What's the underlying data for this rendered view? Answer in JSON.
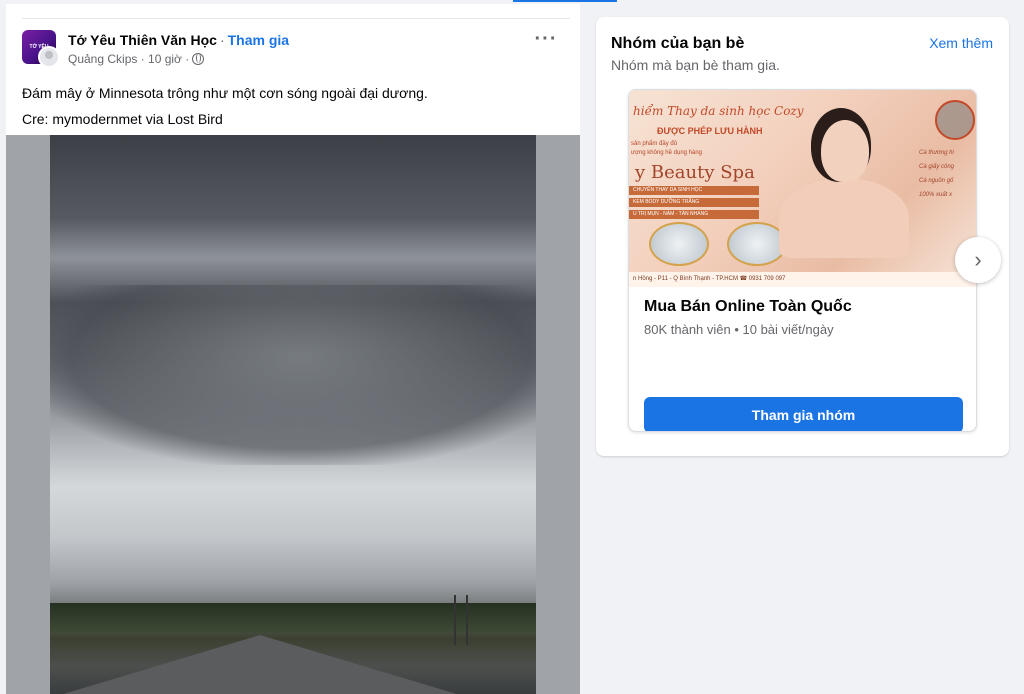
{
  "post": {
    "page_name": "Tớ Yêu Thiên Văn Học",
    "separator": "·",
    "join_label": "Tham gia",
    "meta_text": "Quảng Ckips · 10 giờ ·",
    "avatar_logo_text": "TỚ YÊU",
    "more_label": "···",
    "caption_line1": "Đám mây ở Minnesota trông như một cơn sóng ngoài đại dương.",
    "caption_line2": "Cre: mymodernmet via Lost Bird"
  },
  "panel": {
    "title": "Nhóm của bạn bè",
    "see_more": "Xem thêm",
    "subtitle": "Nhóm mà bạn bè tham gia.",
    "group": {
      "name": "Mua Bán Online Toàn Quốc",
      "meta": "80K thành viên • 10 bài viết/ngày",
      "join_button": "Tham gia nhóm",
      "cover": {
        "script_text": "hiểm Thay da sinh học Cozy",
        "license_text": "ĐƯỢC PHÉP LƯU HÀNH",
        "small_lines": [
          "sản phẩm đầy đủ",
          "ượng không hề dụng hàng"
        ],
        "spa_name": "y Beauty Spa",
        "bands": [
          "CHUYÊN THAY DA SINH HỌC",
          "KEM BODY DƯỠNG TRẮNG",
          "U TRỊ MỤN - NÁM - TÀN NHANG"
        ],
        "bullets": [
          "Cà thương hi",
          "Cà giấy công",
          "Cà nguồn gố",
          "100% xuất x"
        ],
        "footer": "n Hồng - P11 - Q Bình Thạnh - TP.HCM    ☎ 0931 709 097"
      }
    },
    "next_icon": "›"
  },
  "colors": {
    "accent": "#1b74e4",
    "background": "#f0f2f5",
    "secondary_text": "#65676b"
  }
}
